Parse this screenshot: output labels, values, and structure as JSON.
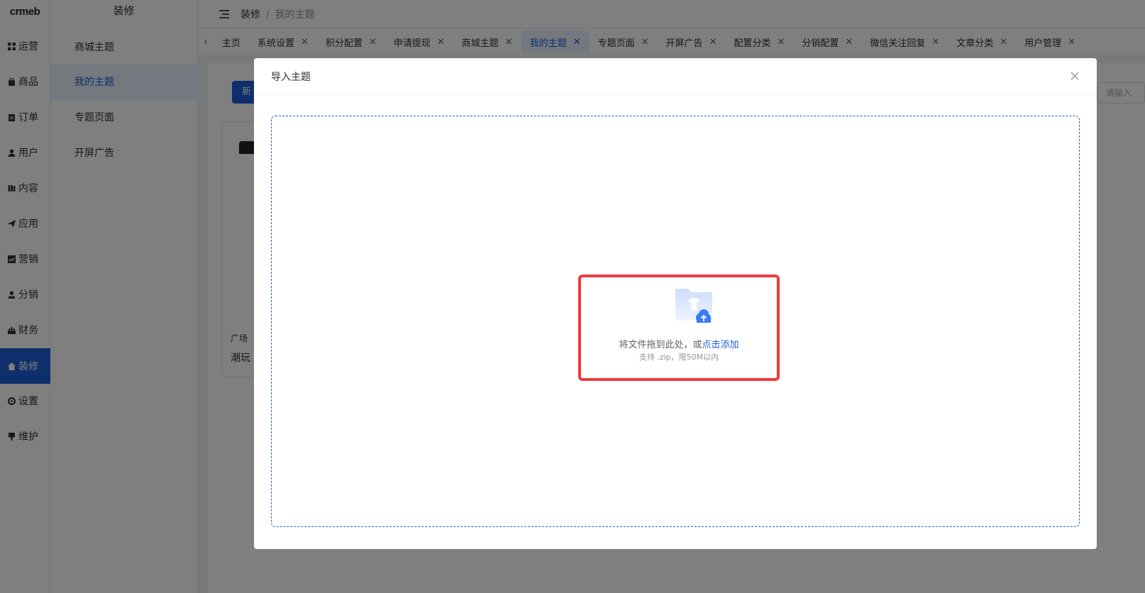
{
  "app": {
    "logo": "crmeb"
  },
  "rail": {
    "items": [
      {
        "label": "运营",
        "icon": "grid-icon"
      },
      {
        "label": "商品",
        "icon": "bag-icon"
      },
      {
        "label": "订单",
        "icon": "clipboard-icon"
      },
      {
        "label": "用户",
        "icon": "user-icon"
      },
      {
        "label": "内容",
        "icon": "book-icon"
      },
      {
        "label": "应用",
        "icon": "send-icon"
      },
      {
        "label": "营销",
        "icon": "chart-icon"
      },
      {
        "label": "分销",
        "icon": "person-icon"
      },
      {
        "label": "财务",
        "icon": "finance-icon"
      },
      {
        "label": "装修",
        "icon": "home-icon"
      },
      {
        "label": "设置",
        "icon": "gear-icon"
      },
      {
        "label": "维护",
        "icon": "tool-icon"
      }
    ]
  },
  "submenu": {
    "title": "装修",
    "items": [
      {
        "label": "商城主题"
      },
      {
        "label": "我的主题"
      },
      {
        "label": "专题页面"
      },
      {
        "label": "开屏广告"
      }
    ]
  },
  "header": {
    "breadcrumb_root": "装修",
    "breadcrumb_sep": "/",
    "breadcrumb_current": "我的主题"
  },
  "tabs": [
    {
      "label": "主页",
      "closable": false
    },
    {
      "label": "系统设置",
      "closable": true
    },
    {
      "label": "积分配置",
      "closable": true
    },
    {
      "label": "申请提现",
      "closable": true
    },
    {
      "label": "商城主题",
      "closable": true
    },
    {
      "label": "我的主题",
      "closable": true
    },
    {
      "label": "专题页面",
      "closable": true
    },
    {
      "label": "开屏广告",
      "closable": true
    },
    {
      "label": "配置分类",
      "closable": true
    },
    {
      "label": "分销配置",
      "closable": true
    },
    {
      "label": "微信关注回复",
      "closable": true
    },
    {
      "label": "文章分类",
      "closable": true
    },
    {
      "label": "用户管理",
      "closable": true
    }
  ],
  "main": {
    "new_button": "新",
    "search_placeholder": "请输入",
    "card": {
      "tag": "广场",
      "name": "潮玩"
    }
  },
  "modal": {
    "title": "导入主题",
    "upload_text": "将文件拖到此处，或",
    "upload_link": "点击添加",
    "upload_tip": "支持 .zip，限50M以内"
  },
  "colors": {
    "primary": "#1e5fd8",
    "highlight": "#f0393c"
  }
}
